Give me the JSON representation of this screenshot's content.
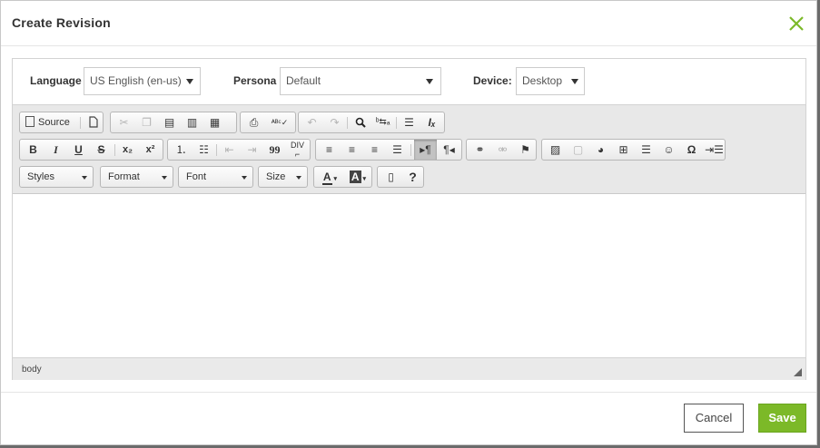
{
  "dialog": {
    "title": "Create Revision",
    "close_label": "×",
    "accent_color": "#7cb928"
  },
  "selectors": {
    "language_label": "Language",
    "language_value": "US English (en-us)",
    "persona_label": "Persona",
    "persona_value": "Default",
    "device_label": "Device:",
    "device_value": "Desktop"
  },
  "toolbar": {
    "source_label": "Source",
    "row2": {
      "bold": "B",
      "italic": "I",
      "underline": "U",
      "strike": "S",
      "subscript": "x₂",
      "superscript": "x²",
      "blockquote": "99"
    },
    "combos": {
      "styles": "Styles",
      "format": "Format",
      "font": "Font",
      "size": "Size"
    },
    "text_color": "A",
    "bg_color": "A",
    "help": "?",
    "special_char": "Ω"
  },
  "statusbar": {
    "path": "body"
  },
  "footer": {
    "cancel_label": "Cancel",
    "save_label": "Save"
  }
}
